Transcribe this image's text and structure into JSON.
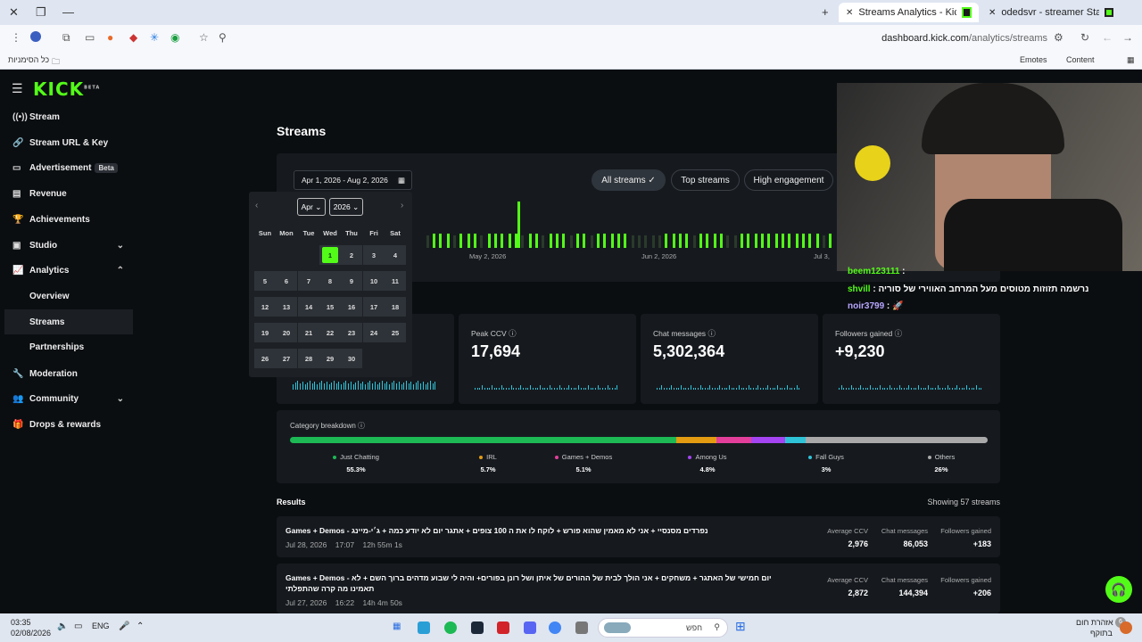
{
  "browser": {
    "tabs": [
      {
        "label": "Streams Analytics - Kick Dashb",
        "active": true
      },
      {
        "label": "odedsvr - streamer Statistics",
        "active": false
      }
    ],
    "url_host": "dashboard.kick.com",
    "url_path": "/analytics/streams",
    "bookmarks_label": "כל הסימניות",
    "bookmark_items": [
      "Emotes",
      "Content"
    ]
  },
  "sidebar": {
    "logo": "KICK",
    "logo_sup": "BETA",
    "items": [
      {
        "label": "Stream",
        "icon": "broadcast-icon"
      },
      {
        "label": "Stream URL & Key",
        "icon": "link-icon"
      },
      {
        "label": "Advertisement",
        "icon": "tv-icon",
        "badge": "Beta"
      },
      {
        "label": "Revenue",
        "icon": "chart-icon"
      },
      {
        "label": "Achievements",
        "icon": "trophy-icon"
      },
      {
        "label": "Studio",
        "icon": "studio-icon"
      },
      {
        "label": "Analytics",
        "icon": "analytics-icon"
      },
      {
        "label": "Overview"
      },
      {
        "label": "Streams"
      },
      {
        "label": "Partnerships"
      },
      {
        "label": "Moderation",
        "icon": "wrench-icon"
      },
      {
        "label": "Community",
        "icon": "community-icon"
      },
      {
        "label": "Drops & rewards",
        "icon": "gift-icon"
      }
    ]
  },
  "page": {
    "title": "Streams",
    "date_range": "Apr 1, 2026 - Aug 2, 2026",
    "filters": [
      "All streams ✓",
      "Top streams",
      "High engagement"
    ],
    "x_ticks": [
      "May 2, 2026",
      "Jun 2, 2026",
      "Jul 3,"
    ]
  },
  "calendar": {
    "month": "Apr",
    "year": "2026",
    "weekdays": [
      "Sun",
      "Mon",
      "Tue",
      "Wed",
      "Thu",
      "Fri",
      "Sat"
    ],
    "selected_day": "1"
  },
  "stats": [
    {
      "label": "Peak CCV",
      "value": "17,694"
    },
    {
      "label": "Chat messages",
      "value": "5,302,364"
    },
    {
      "label": "Followers gained",
      "value": "+9,230"
    }
  ],
  "categories": {
    "title": "Category breakdown",
    "items": [
      {
        "name": "Just Chatting",
        "pct": "55.3%",
        "value": 55.3,
        "color": "#1db954"
      },
      {
        "name": "IRL",
        "pct": "5.7%",
        "value": 5.7,
        "color": "#e39b12"
      },
      {
        "name": "Games + Demos",
        "pct": "5.1%",
        "value": 5.1,
        "color": "#e33f9a"
      },
      {
        "name": "Among Us",
        "pct": "4.8%",
        "value": 4.8,
        "color": "#a544f2"
      },
      {
        "name": "Fall Guys",
        "pct": "3%",
        "value": 3,
        "color": "#2fc3d8"
      },
      {
        "name": "Others",
        "pct": "26%",
        "value": 26,
        "color": "#a9a9a9"
      }
    ]
  },
  "results": {
    "title": "Results",
    "count_label": "Showing 57 streams",
    "col_labels": [
      "Average CCV",
      "Chat messages",
      "Followers gained"
    ],
    "rows": [
      {
        "title": "Games + Demos - נפרדים מסנסיי + אני לא מאמין שהוא פורש + לוקח לו את ה 100 צופים + אתגר יום לא יודע כמה + ג׳י-מיינג",
        "date": "Jul 28, 2026",
        "time": "17:07",
        "duration": "12h 55m 1s",
        "avg_ccv": "2,976",
        "chat": "86,053",
        "followers": "+183"
      },
      {
        "title": "Games + Demos - יום חמישי של האתגר + משחקים + אני הולך לבית של ההורים של איתן ושל רונן בפורים+ והיה לי שבוע מדהים ברוך השם + לא תאמינו מה קרה שהתפלתי",
        "date": "Jul 27, 2026",
        "time": "16:22",
        "duration": "14h 4m 50s",
        "avg_ccv": "2,872",
        "chat": "144,394",
        "followers": "+206"
      }
    ]
  },
  "chat_overlay": [
    {
      "user": "beem123111",
      "text": ":"
    },
    {
      "user": "shvill",
      "text": ": נרשמה תזוזות מטוסים מעל המרחב האווירי של סוריה"
    },
    {
      "user": "noir3799",
      "text": ":"
    }
  ],
  "taskbar": {
    "time": "03:35",
    "date": "02/08/2026",
    "lang": "ENG",
    "search_placeholder": "חפש",
    "weather_title": "אזהרת חום",
    "weather_sub": "בתוקף",
    "notif_count": "6"
  }
}
